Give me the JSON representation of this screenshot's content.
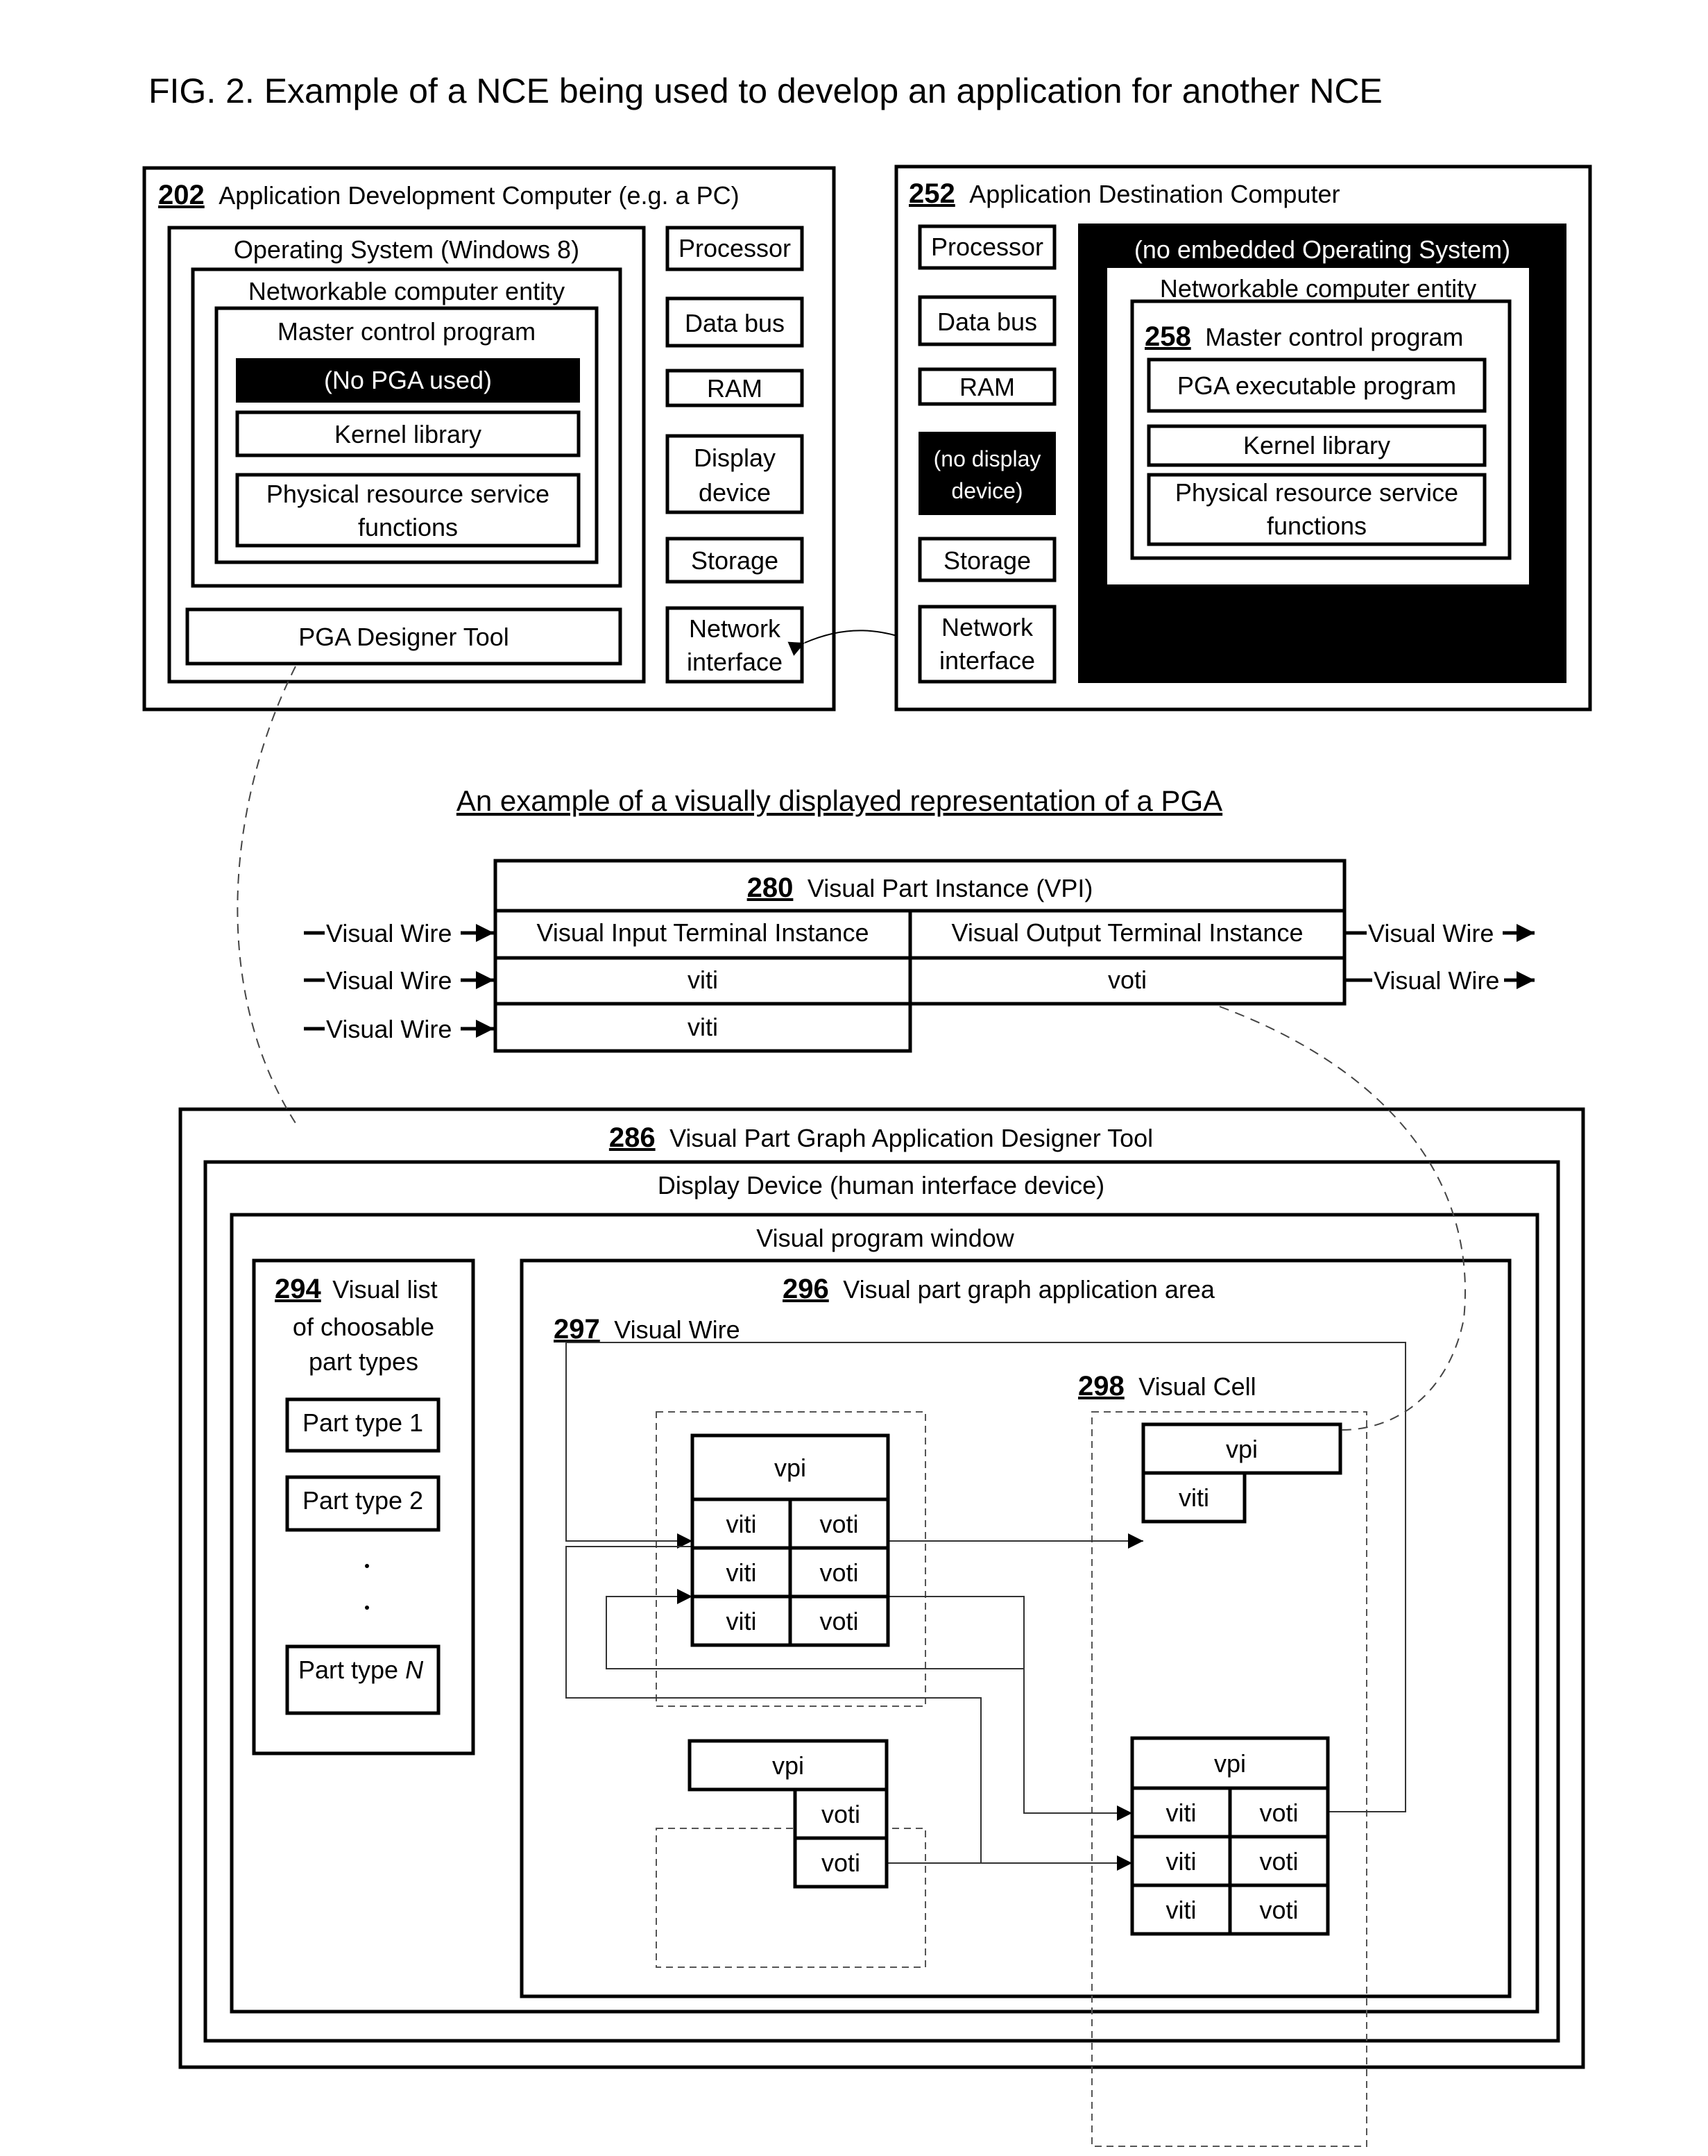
{
  "figure_title": "FIG. 2.  Example of a NCE being used to develop an application for another NCE",
  "dev_computer": {
    "ref": "202",
    "title": "Application Development Computer (e.g. a PC)",
    "os": "Operating System (Windows 8)",
    "nce": "Networkable computer entity",
    "mcp": "Master control program",
    "no_pga": "(No PGA used)",
    "kernel": "Kernel library",
    "phys_line1": "Physical resource service",
    "phys_line2": "functions",
    "designer_tool": "PGA Designer Tool",
    "hardware": {
      "processor": "Processor",
      "data_bus": "Data bus",
      "ram": "RAM",
      "display_line1": "Display",
      "display_line2": "device",
      "storage": "Storage",
      "network_line1": "Network",
      "network_line2": "interface"
    }
  },
  "dest_computer": {
    "ref": "252",
    "title": "Application Destination Computer",
    "os": "(no embedded Operating System)",
    "nce": "Networkable computer entity",
    "mcp_ref": "258",
    "mcp": "Master control program",
    "pga_exec": "PGA executable program",
    "kernel": "Kernel library",
    "phys_line1": "Physical resource service",
    "phys_line2": "functions",
    "hardware": {
      "processor": "Processor",
      "data_bus": "Data bus",
      "ram": "RAM",
      "no_display_line1": "(no display",
      "no_display_line2": "device)",
      "storage": "Storage",
      "network_line1": "Network",
      "network_line2": "interface"
    }
  },
  "pga_example": {
    "subtitle": "An example of a visually displayed representation of a PGA",
    "vpi_ref": "280",
    "vpi_title": "Visual Part Instance (VPI)",
    "input_header": "Visual Input Terminal Instance",
    "output_header": "Visual Output Terminal Instance",
    "viti": "viti",
    "voti": "voti",
    "wire_label": "Visual Wire"
  },
  "designer": {
    "ref": "286",
    "title": "Visual Part Graph Application Designer Tool",
    "display_device": "Display Device (human interface device)",
    "program_window": "Visual program window",
    "list_ref": "294",
    "list_line1": "Visual list",
    "list_line2": "of choosable",
    "list_line3": "part types",
    "part_types": [
      "Part type 1",
      "Part type 2"
    ],
    "part_type_n_prefix": "Part type ",
    "part_type_n_var": "N",
    "area_ref": "296",
    "area_title": "Visual part graph application area",
    "wire_ref": "297",
    "wire_title": "Visual Wire",
    "cell_ref": "298",
    "cell_title": "Visual Cell",
    "vpi": "vpi",
    "viti": "viti",
    "voti": "voti"
  }
}
